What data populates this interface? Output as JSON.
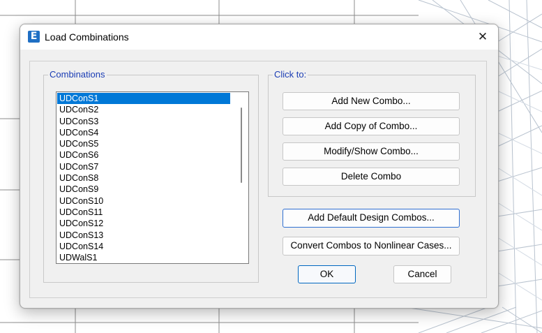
{
  "dialog": {
    "title": "Load Combinations",
    "app_icon_letter": "E",
    "close_glyph": "✕"
  },
  "combinations": {
    "group_label": "Combinations",
    "selected_index": 0,
    "items": [
      "UDConS1",
      "UDConS2",
      "UDConS3",
      "UDConS4",
      "UDConS5",
      "UDConS6",
      "UDConS7",
      "UDConS8",
      "UDConS9",
      "UDConS10",
      "UDConS11",
      "UDConS12",
      "UDConS13",
      "UDConS14",
      "UDWalS1"
    ]
  },
  "click_to": {
    "group_label": "Click to:",
    "add_new": "Add New Combo...",
    "add_copy": "Add Copy of Combo...",
    "modify_show": "Modify/Show Combo...",
    "delete": "Delete Combo"
  },
  "actions": {
    "add_default": "Add Default Design Combos...",
    "convert": "Convert Combos to Nonlinear Cases...",
    "ok": "OK",
    "cancel": "Cancel"
  },
  "colors": {
    "accent": "#0078d7",
    "group_label": "#1a3cb4"
  }
}
